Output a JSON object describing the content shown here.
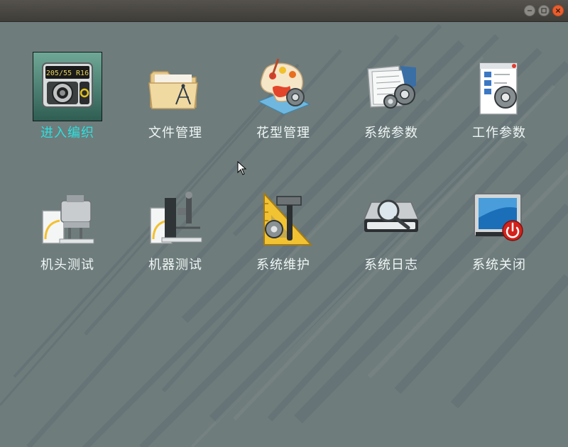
{
  "window": {
    "controls": [
      "minimize",
      "maximize",
      "close"
    ]
  },
  "menu": {
    "items": [
      {
        "label": "进入编织",
        "icon": "knitting-machine-icon",
        "selected": true,
        "display": "205/55 R16"
      },
      {
        "label": "文件管理",
        "icon": "folder-icon",
        "selected": false
      },
      {
        "label": "花型管理",
        "icon": "palette-icon",
        "selected": false
      },
      {
        "label": "系统参数",
        "icon": "system-params-icon",
        "selected": false
      },
      {
        "label": "工作参数",
        "icon": "work-params-icon",
        "selected": false
      },
      {
        "label": "机头测试",
        "icon": "head-test-icon",
        "selected": false
      },
      {
        "label": "机器测试",
        "icon": "machine-test-icon",
        "selected": false
      },
      {
        "label": "系统维护",
        "icon": "maintenance-icon",
        "selected": false
      },
      {
        "label": "系统日志",
        "icon": "system-log-icon",
        "selected": false
      },
      {
        "label": "系统关闭",
        "icon": "power-off-icon",
        "selected": false
      }
    ]
  },
  "colors": {
    "desktop_bg": "#6f7c7c",
    "selected_label": "#29e2e0",
    "label": "#eef6f4",
    "close_button": "#e95e2e"
  }
}
